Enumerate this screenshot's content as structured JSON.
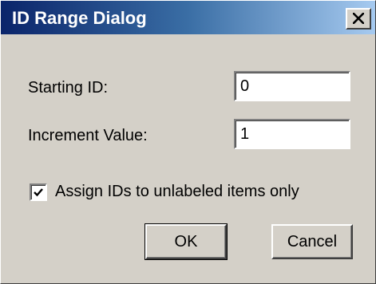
{
  "window": {
    "title": "ID Range Dialog",
    "close_glyph": "close-icon"
  },
  "fields": {
    "starting_id": {
      "label": "Starting ID:",
      "value": "0"
    },
    "increment": {
      "label": "Increment Value:",
      "value": "1"
    }
  },
  "options": {
    "unlabeled_only": {
      "label": "Assign IDs to unlabeled items only",
      "checked": true
    }
  },
  "buttons": {
    "ok": "OK",
    "cancel": "Cancel"
  },
  "colors": {
    "face": "#d4d0c8",
    "title_start": "#0a246a",
    "title_end": "#a6caf0"
  }
}
